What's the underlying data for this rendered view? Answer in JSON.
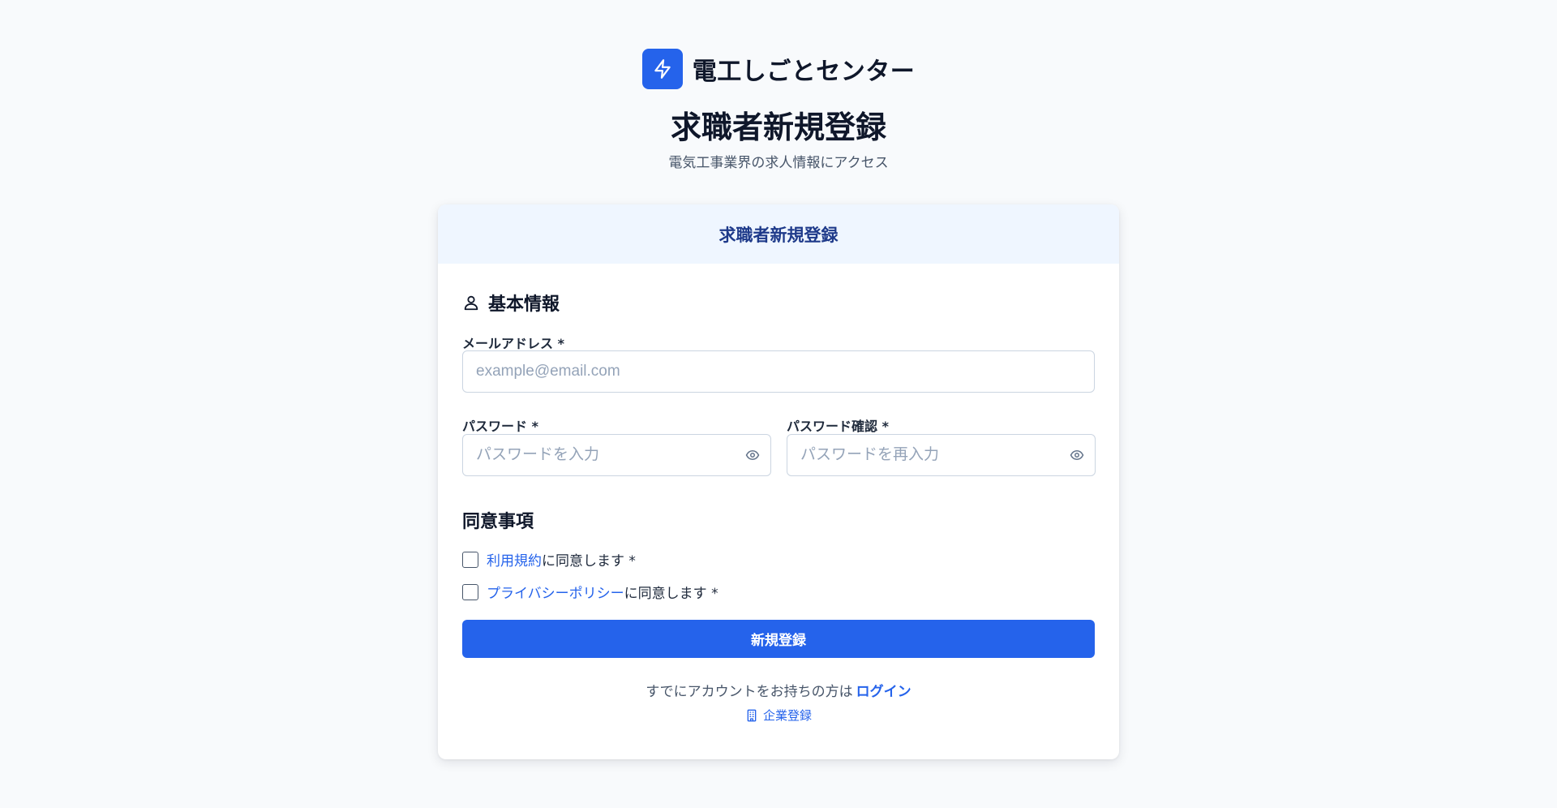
{
  "brand": {
    "name": "電工しごとセンター",
    "logo_icon": "bolt-icon",
    "accent": "#2563eb"
  },
  "page": {
    "title": "求職者新規登録",
    "subtitle": "電気工事業界の求人情報にアクセス"
  },
  "card": {
    "header_title": "求職者新規登録",
    "basic_section": {
      "icon": "user-icon",
      "title": "基本情報"
    },
    "email": {
      "label": "メールアドレス *",
      "placeholder": "example@email.com",
      "value": ""
    },
    "password": {
      "label": "パスワード *",
      "placeholder": "パスワードを入力",
      "value": ""
    },
    "password_confirm": {
      "label": "パスワード確認 *",
      "placeholder": "パスワードを再入力",
      "value": ""
    },
    "agree_section": {
      "title": "同意事項"
    },
    "terms": {
      "link": "利用規約",
      "suffix": "に同意します *",
      "checked": false
    },
    "privacy": {
      "link": "プライバシーポリシー",
      "suffix": "に同意します *",
      "checked": false
    },
    "submit_label": "新規登録",
    "login_prompt": "すでにアカウントをお持ちの方は",
    "login_link": "ログイン",
    "company_icon": "building-icon",
    "company_link": "企業登録"
  }
}
